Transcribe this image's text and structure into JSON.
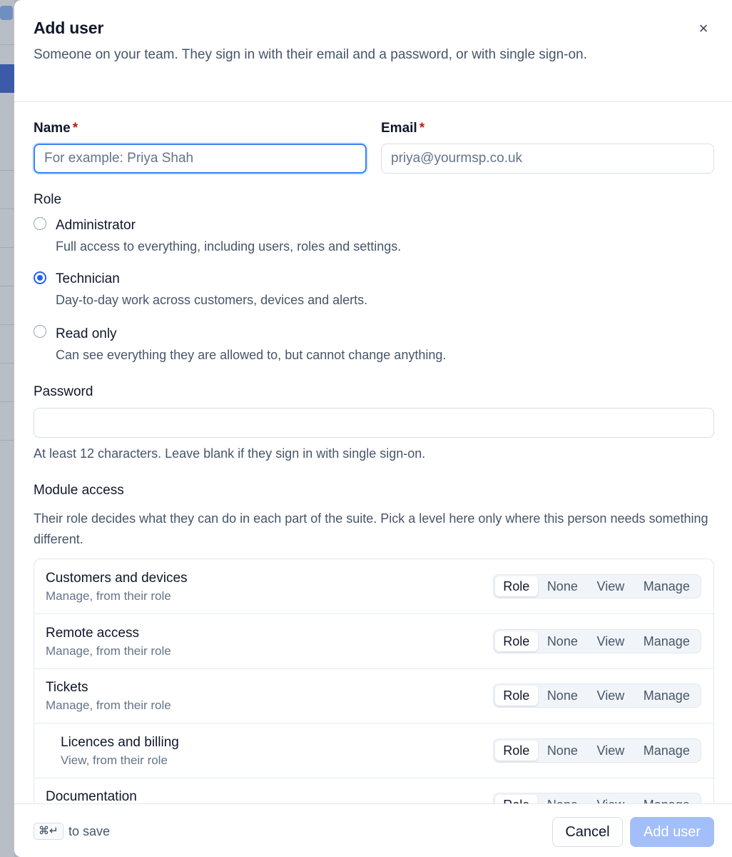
{
  "dialog": {
    "title": "Add user",
    "subtitle": "Someone on your team. They sign in with their email and a password, or with single sign-on.",
    "close_icon": "×"
  },
  "form": {
    "name": {
      "label": "Name",
      "required": "*",
      "placeholder": "For example: Priya Shah",
      "value": ""
    },
    "email": {
      "label": "Email",
      "required": "*",
      "placeholder": "priya@yourmsp.co.uk",
      "value": ""
    },
    "role": {
      "label": "Role",
      "selected": "Technician",
      "options": [
        {
          "title": "Administrator",
          "description": "Full access to everything, including users, roles and settings."
        },
        {
          "title": "Technician",
          "description": "Day-to-day work across customers, devices and alerts."
        },
        {
          "title": "Read only",
          "description": "Can see everything they are allowed to, but cannot change anything."
        }
      ]
    },
    "password": {
      "label": "Password",
      "value": "",
      "help": "At least 12 characters. Leave blank if they sign in with single sign-on."
    },
    "module_access": {
      "label": "Module access",
      "description": "Their role decides what they can do in each part of the suite. Pick a level here only where this person needs something different.",
      "levels": [
        "Role",
        "None",
        "View",
        "Manage"
      ],
      "modules": [
        {
          "name": "Customers and devices",
          "sub": "Manage, from their role",
          "selected": "Role",
          "indent": false
        },
        {
          "name": "Remote access",
          "sub": "Manage, from their role",
          "selected": "Role",
          "indent": false
        },
        {
          "name": "Tickets",
          "sub": "Manage, from their role",
          "selected": "Role",
          "indent": false
        },
        {
          "name": "Licences and billing",
          "sub": "View, from their role",
          "selected": "Role",
          "indent": true
        },
        {
          "name": "Documentation",
          "sub": "",
          "selected": "Role",
          "indent": false
        }
      ]
    }
  },
  "footer": {
    "shortcut_keys": "⌘↵",
    "shortcut_text": "to save",
    "cancel_label": "Cancel",
    "submit_label": "Add user"
  },
  "colors": {
    "accent": "#2563eb",
    "primary_disabled": "#a3bffa",
    "required": "#b91c1c"
  }
}
